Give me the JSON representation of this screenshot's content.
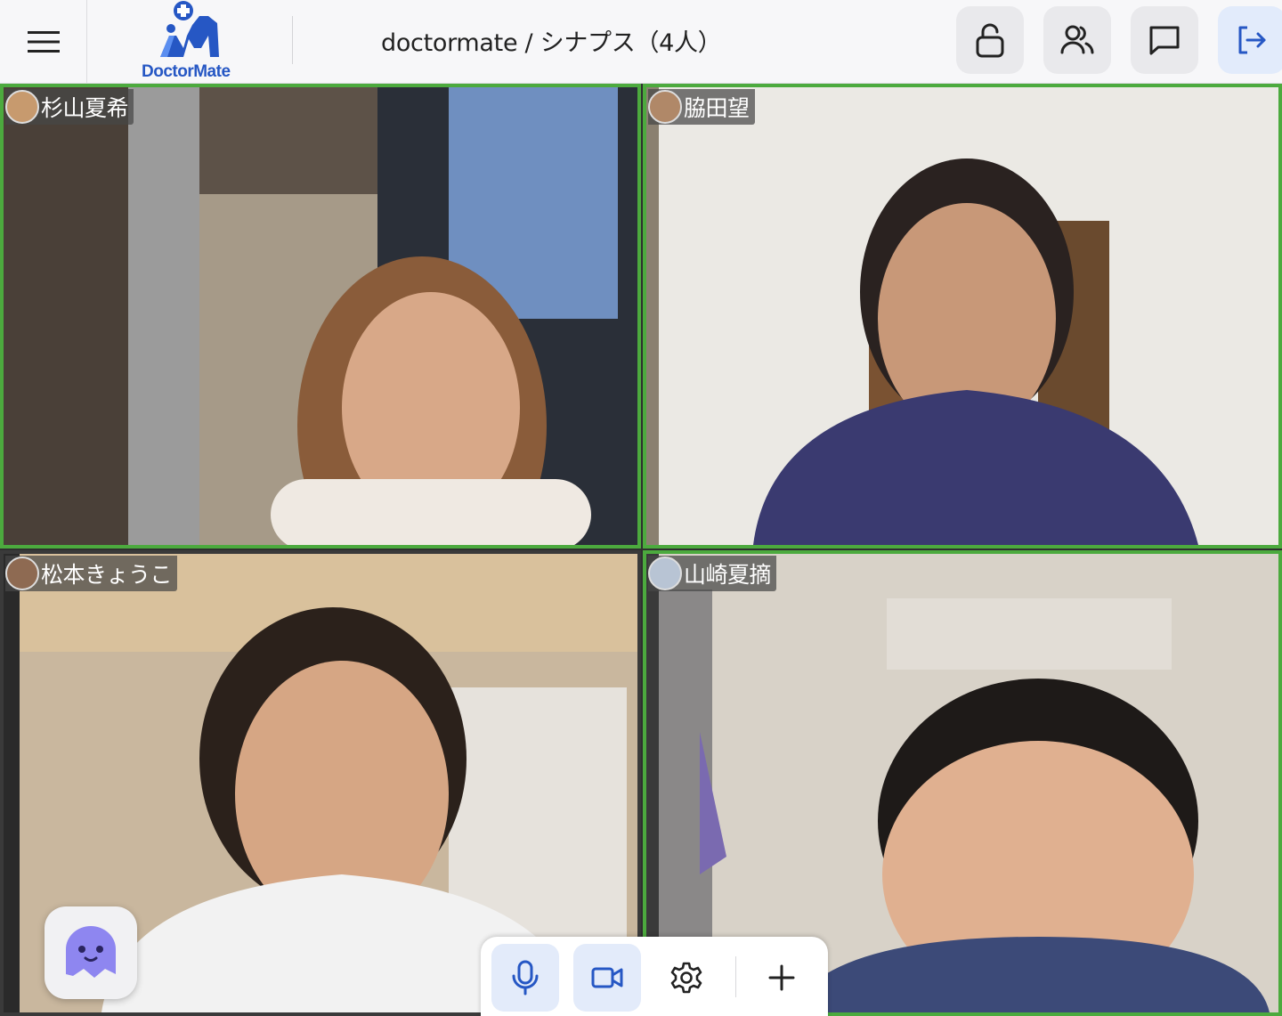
{
  "header": {
    "logo_text": "DoctorMate",
    "title": "doctormate / シナプス（4人）",
    "buttons": [
      {
        "icon": "lock-open-icon"
      },
      {
        "icon": "users-icon"
      },
      {
        "icon": "chat-icon"
      },
      {
        "icon": "exit-icon"
      }
    ]
  },
  "participants": [
    {
      "name": "杉山夏希",
      "speaking": true
    },
    {
      "name": "脇田望",
      "speaking": true
    },
    {
      "name": "松本きょうこ",
      "speaking": false
    },
    {
      "name": "山崎夏摘",
      "speaking": true
    }
  ],
  "controls": {
    "items": [
      {
        "icon": "microphone-icon",
        "active": true
      },
      {
        "icon": "camera-icon",
        "active": true
      },
      {
        "icon": "gear-icon",
        "active": false
      },
      {
        "icon": "plus-icon",
        "active": false
      }
    ]
  },
  "colors": {
    "accent": "#2657c4",
    "speaking_border": "#4caa3e",
    "assistant": "#8e86f0"
  }
}
